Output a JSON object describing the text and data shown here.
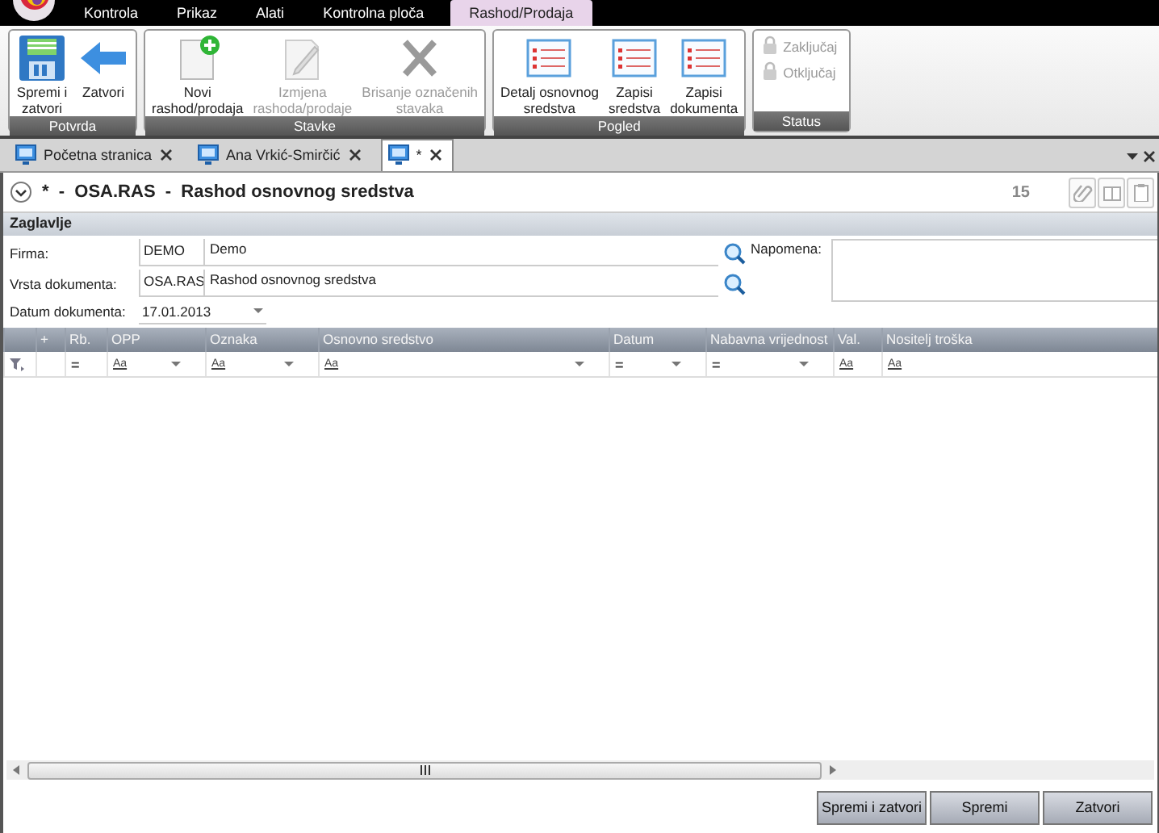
{
  "menu": [
    {
      "label": "Kontrola",
      "selected": false
    },
    {
      "label": "Prikaz",
      "selected": false
    },
    {
      "label": "Alati",
      "selected": false
    },
    {
      "label": "Kontrolna ploča",
      "selected": false
    },
    {
      "label": "Rashod/Prodaja",
      "selected": true
    }
  ],
  "ribbon": [
    {
      "title": "Potvrda",
      "kind": "large",
      "buttons": [
        {
          "label": "Spremi i\nzatvori",
          "kind": "save",
          "disabled": false
        },
        {
          "label": "Zatvori",
          "kind": "back",
          "disabled": false
        }
      ]
    },
    {
      "title": "Stavke",
      "kind": "large",
      "buttons": [
        {
          "label": "Novi\nrashod/prodaja",
          "kind": "new",
          "disabled": false
        },
        {
          "label": "Izmjena\nrashoda/prodaje",
          "kind": "edit",
          "disabled": true
        },
        {
          "label": "Brisanje označenih\nstavaka",
          "kind": "delete",
          "disabled": true
        }
      ]
    },
    {
      "title": "Pogled",
      "kind": "large",
      "buttons": [
        {
          "label": "Detalj osnovnog\nsredstva",
          "kind": "list",
          "disabled": false
        },
        {
          "label": "Zapisi\nsredstva",
          "kind": "list",
          "disabled": false
        },
        {
          "label": "Zapisi\ndokumenta",
          "kind": "list",
          "disabled": false
        }
      ]
    },
    {
      "title": "Status",
      "kind": "small",
      "buttons": [
        {
          "label": "Zaključaj",
          "kind": "lock",
          "disabled": true
        },
        {
          "label": "Otključaj",
          "kind": "lock",
          "disabled": true
        }
      ]
    }
  ],
  "doc_tabs": [
    {
      "label": "Početna stranica",
      "selected": false
    },
    {
      "label": "Ana Vrkić-Smirčić",
      "selected": false
    },
    {
      "label": "*",
      "selected": true
    }
  ],
  "document": {
    "title": "*  -  OSA.RAS  -  Rashod osnovnog sredstva",
    "number": "15"
  },
  "header": {
    "title": "Zaglavlje",
    "fields": [
      {
        "label": "Firma:",
        "kind": "lookup",
        "code": "DEMO",
        "value": "Demo"
      },
      {
        "label": "Vrsta dokumenta:",
        "kind": "lookup",
        "code": "OSA.RAS",
        "value": "Rashod osnovnog sredstva"
      },
      {
        "label": "Datum dokumenta:",
        "kind": "date",
        "value": "17.01.2013"
      }
    ],
    "note": {
      "label": "Napomena:"
    }
  },
  "grid": {
    "columns": [
      {
        "title": "+"
      },
      {
        "title": "Rb.",
        "filter": "=",
        "dropdown": false
      },
      {
        "title": "OPP",
        "filter": "Aa",
        "dropdown": true
      },
      {
        "title": "Oznaka",
        "filter": "Aa",
        "dropdown": true
      },
      {
        "title": "Osnovno sredstvo",
        "filter": "Aa",
        "dropdown": true
      },
      {
        "title": "Datum",
        "filter": "=",
        "dropdown": true
      },
      {
        "title": "Nabavna vrijednost",
        "filter": "=",
        "dropdown": true
      },
      {
        "title": "Val.",
        "filter": "Aa",
        "dropdown": false
      },
      {
        "title": "Nositelj troška",
        "filter": "Aa",
        "dropdown": false
      }
    ]
  },
  "footer_buttons": [
    "Spremi i zatvori",
    "Spremi",
    "Zatvori"
  ]
}
